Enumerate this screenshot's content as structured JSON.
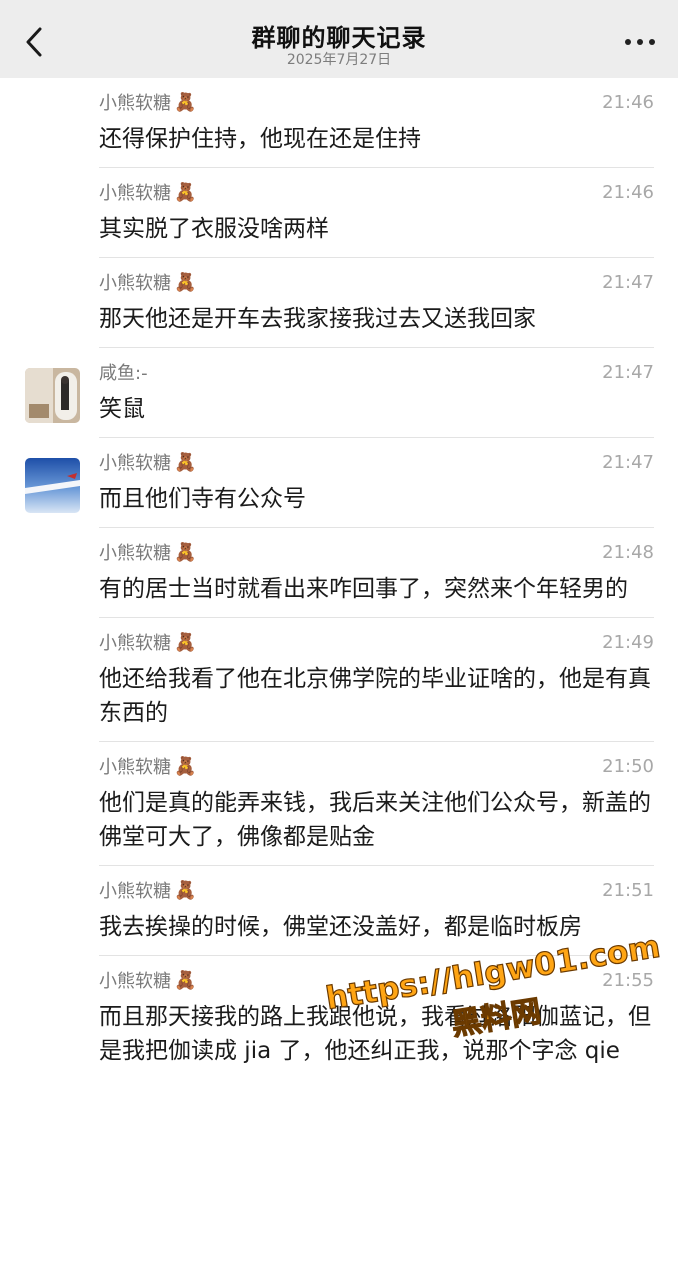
{
  "header": {
    "title": "群聊的聊天记录",
    "subtitle": "2025年7月27日"
  },
  "icons": {
    "back": "chevron-left-icon",
    "more": "more-dots-icon",
    "sticker": "teddy-bear-emoji"
  },
  "messages": [
    {
      "sender": "小熊软糖",
      "bear": "🧸",
      "time": "21:46",
      "text": "还得保护住持，他现在还是住持"
    },
    {
      "sender": "小熊软糖",
      "bear": "🧸",
      "time": "21:46",
      "text": "其实脱了衣服没啥两样"
    },
    {
      "sender": "小熊软糖",
      "bear": "🧸",
      "time": "21:47",
      "text": "那天他还是开车去我家接我过去又送我回家"
    },
    {
      "sender": "咸鱼:-",
      "bear": "",
      "time": "21:47",
      "text": "笑鼠"
    },
    {
      "sender": "小熊软糖",
      "bear": "🧸",
      "time": "21:47",
      "text": "而且他们寺有公众号"
    },
    {
      "sender": "小熊软糖",
      "bear": "🧸",
      "time": "21:48",
      "text": "有的居士当时就看出来咋回事了，突然来个年轻男的"
    },
    {
      "sender": "小熊软糖",
      "bear": "🧸",
      "time": "21:49",
      "text": "他还给我看了他在北京佛学院的毕业证啥的，他是有真东西的"
    },
    {
      "sender": "小熊软糖",
      "bear": "🧸",
      "time": "21:50",
      "text": "他们是真的能弄来钱，我后来关注他们公众号，新盖的佛堂可大了，佛像都是贴金"
    },
    {
      "sender": "小熊软糖",
      "bear": "🧸",
      "time": "21:51",
      "text": "我去挨操的时候，佛堂还没盖好，都是临时板房"
    },
    {
      "sender": "小熊软糖",
      "bear": "🧸",
      "time": "21:55",
      "text": "而且那天接我的路上我跟他说，我看过洛阳伽蓝记，但是我把伽读成 jia 了，他还纠正我，说那个字念 qie"
    }
  ],
  "watermark": {
    "url": "https://hlgw01.com",
    "name": "黑料网"
  },
  "colors": {
    "header_bg": "#ededed",
    "watermark_fill": "#ffa514",
    "divider": "#e3e3e3"
  }
}
